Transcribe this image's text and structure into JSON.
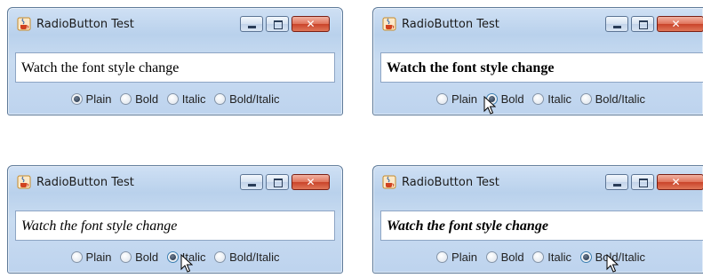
{
  "windows": [
    {
      "title": "RadioButton Test",
      "controls": {
        "minimize": "–",
        "maximize": "□",
        "close": "✕"
      },
      "text_field": {
        "value": "Watch the font style change",
        "style": "plain"
      },
      "radio_options": [
        "Plain",
        "Bold",
        "Italic",
        "Bold/Italic"
      ],
      "selected": "Plain"
    },
    {
      "title": "RadioButton Test",
      "controls": {
        "minimize": "–",
        "maximize": "□",
        "close": "✕"
      },
      "text_field": {
        "value": "Watch the font style change",
        "style": "bold"
      },
      "radio_options": [
        "Plain",
        "Bold",
        "Italic",
        "Bold/Italic"
      ],
      "selected": "Bold"
    },
    {
      "title": "RadioButton Test",
      "controls": {
        "minimize": "–",
        "maximize": "□",
        "close": "✕"
      },
      "text_field": {
        "value": "Watch the font style change",
        "style": "italic"
      },
      "radio_options": [
        "Plain",
        "Bold",
        "Italic",
        "Bold/Italic"
      ],
      "selected": "Italic"
    },
    {
      "title": "RadioButton Test",
      "controls": {
        "minimize": "–",
        "maximize": "□",
        "close": "✕"
      },
      "text_field": {
        "value": "Watch the font style change",
        "style": "bold-italic"
      },
      "radio_options": [
        "Plain",
        "Bold",
        "Italic",
        "Bold/Italic"
      ],
      "selected": "Bold/Italic"
    }
  ],
  "icons": {
    "app": "java-cup-icon",
    "cursor": "mouse-pointer-icon"
  },
  "colors": {
    "window_frame": "#5e7a99",
    "window_body": "#c4d8ef",
    "close_button": "#d9563b",
    "radio_border": "#8494a8"
  }
}
